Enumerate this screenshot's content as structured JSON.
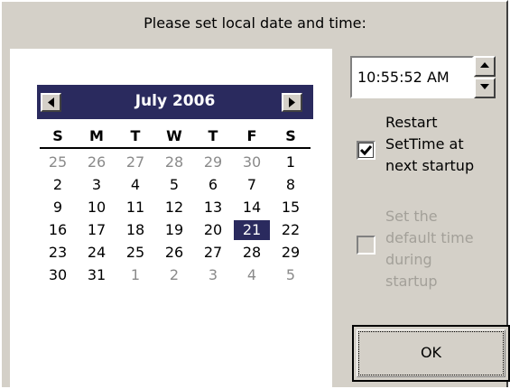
{
  "dialog": {
    "prompt": "Please set local date and time:"
  },
  "calendar": {
    "month_label": "July 2006",
    "prev_icon": "left-triangle-icon",
    "next_icon": "right-triangle-icon",
    "weekdays": [
      "S",
      "M",
      "T",
      "W",
      "T",
      "F",
      "S"
    ],
    "weeks": [
      [
        {
          "d": "25",
          "other": true
        },
        {
          "d": "26",
          "other": true
        },
        {
          "d": "27",
          "other": true
        },
        {
          "d": "28",
          "other": true
        },
        {
          "d": "29",
          "other": true
        },
        {
          "d": "30",
          "other": true
        },
        {
          "d": "1"
        }
      ],
      [
        {
          "d": "2"
        },
        {
          "d": "3"
        },
        {
          "d": "4"
        },
        {
          "d": "5"
        },
        {
          "d": "6"
        },
        {
          "d": "7"
        },
        {
          "d": "8"
        }
      ],
      [
        {
          "d": "9"
        },
        {
          "d": "10"
        },
        {
          "d": "11"
        },
        {
          "d": "12"
        },
        {
          "d": "13"
        },
        {
          "d": "14"
        },
        {
          "d": "15"
        }
      ],
      [
        {
          "d": "16"
        },
        {
          "d": "17"
        },
        {
          "d": "18"
        },
        {
          "d": "19"
        },
        {
          "d": "20"
        },
        {
          "d": "21",
          "selected": true
        },
        {
          "d": "22"
        }
      ],
      [
        {
          "d": "23"
        },
        {
          "d": "24"
        },
        {
          "d": "25"
        },
        {
          "d": "26"
        },
        {
          "d": "27"
        },
        {
          "d": "28"
        },
        {
          "d": "29"
        }
      ],
      [
        {
          "d": "30"
        },
        {
          "d": "31"
        },
        {
          "d": "1",
          "other": true
        },
        {
          "d": "2",
          "other": true
        },
        {
          "d": "3",
          "other": true
        },
        {
          "d": "4",
          "other": true
        },
        {
          "d": "5",
          "other": true
        }
      ]
    ],
    "colors": {
      "header_bg": "#2a2a5e",
      "selected_bg": "#2a2a5e",
      "other_month_text": "#8a8a8a"
    }
  },
  "time": {
    "value": "10:55:52 AM",
    "up_icon": "spin-up-arrow-icon",
    "down_icon": "spin-down-arrow-icon"
  },
  "options": {
    "restart": {
      "lines": [
        "Restart",
        "SetTime at",
        "next startup"
      ],
      "checked": true,
      "enabled": true
    },
    "default_time": {
      "lines": [
        "Set the",
        "default time",
        "during",
        "startup"
      ],
      "checked": false,
      "enabled": false
    }
  },
  "buttons": {
    "ok_label": "OK"
  }
}
